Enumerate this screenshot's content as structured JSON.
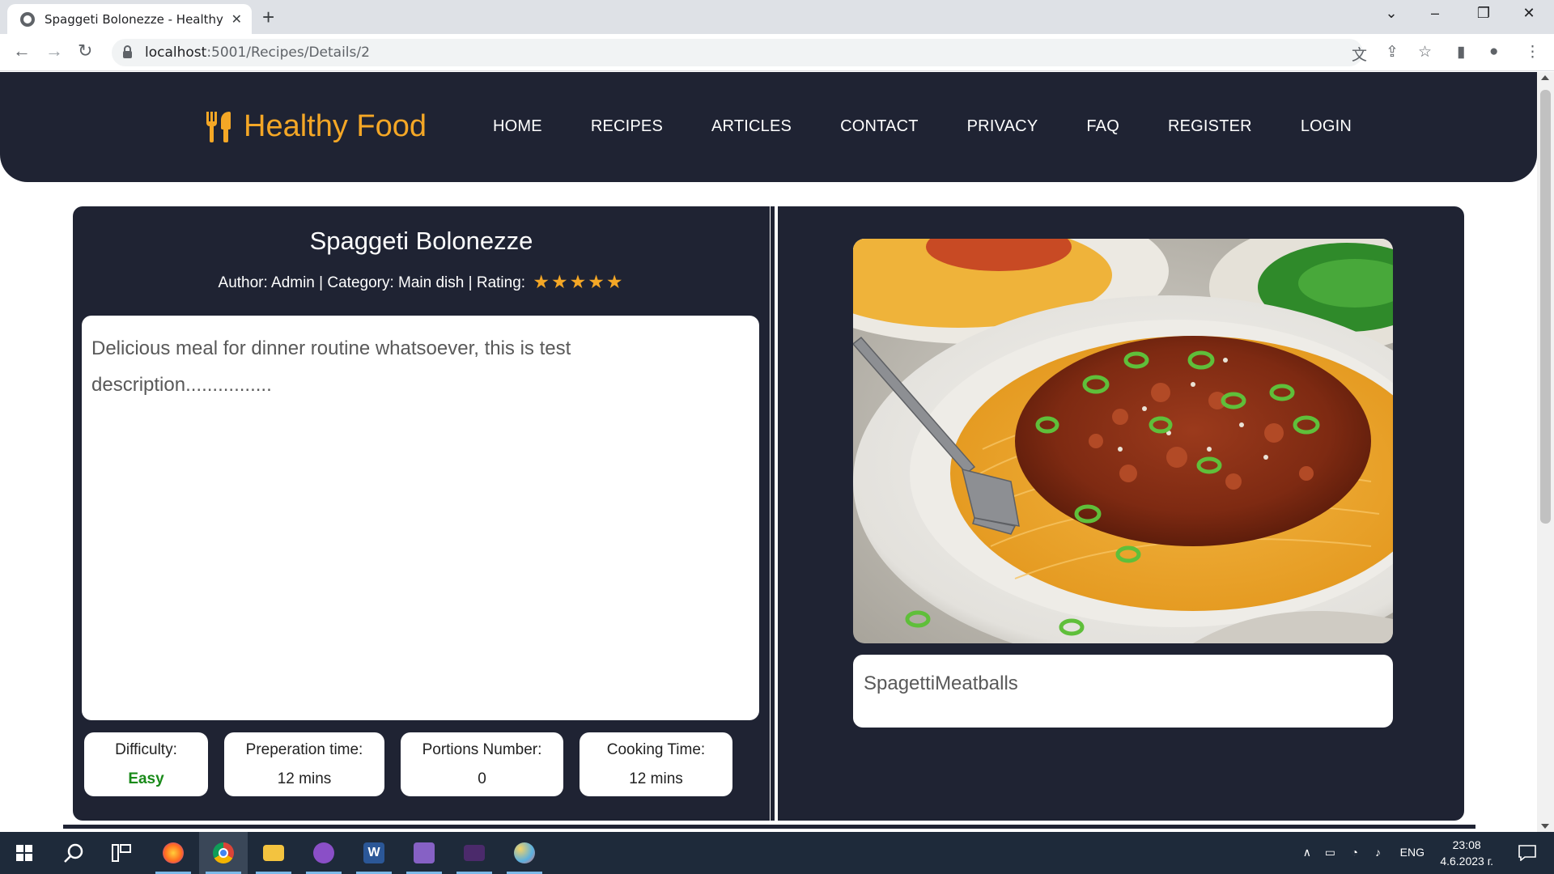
{
  "browser": {
    "tab_title": "Spaggeti Bolonezze - Healthy Food",
    "url_host": "localhost",
    "url_path": ":5001/Recipes/Details/2"
  },
  "site": {
    "brand": "Healthy Food",
    "nav": [
      "HOME",
      "RECIPES",
      "ARTICLES",
      "CONTACT",
      "PRIVACY",
      "FAQ",
      "REGISTER",
      "LOGIN"
    ],
    "accent_color": "#f4a726",
    "header_color": "#1f2333"
  },
  "recipe": {
    "title": "Spaggeti Bolonezze",
    "author_label": "Author:",
    "author": "Admin",
    "category_label": "Category:",
    "category": "Main dish",
    "rating_label": "Rating:",
    "rating": 5,
    "rating_max": 5,
    "description": "Delicious meal for dinner routine whatsoever, this is test description................",
    "image_caption": "SpagettiMeatballs",
    "stats": [
      {
        "label": "Difficulty:",
        "value": "Easy"
      },
      {
        "label": "Preperation time:",
        "value": "12 mins"
      },
      {
        "label": "Portions Number:",
        "value": "0"
      },
      {
        "label": "Cooking Time:",
        "value": "12 mins"
      }
    ]
  },
  "taskbar": {
    "apps": [
      "firefox-icon",
      "chrome-icon",
      "file-explorer-icon",
      "github-desktop-icon",
      "word-icon",
      "visual-studio-icon",
      "terminal-icon",
      "paint-icon"
    ],
    "language": "ENG",
    "time": "23:08",
    "date": "4.6.2023 г."
  }
}
